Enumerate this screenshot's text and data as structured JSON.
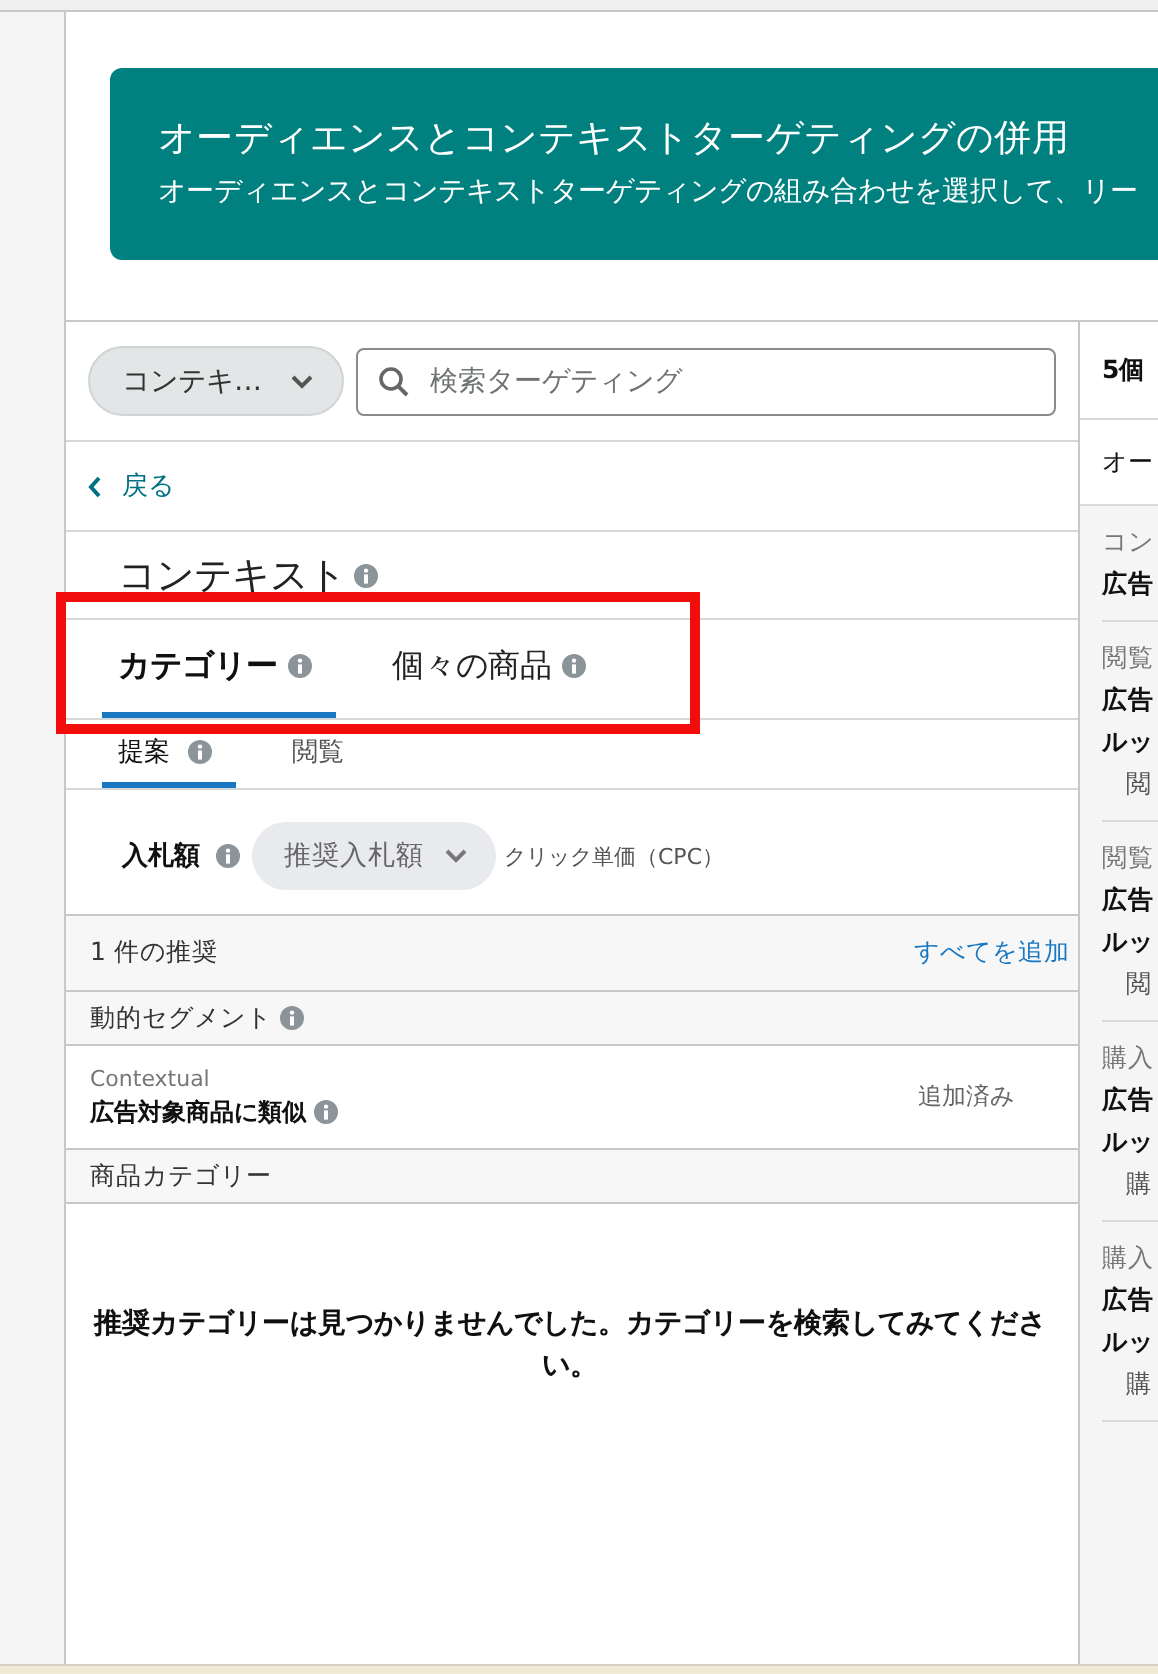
{
  "banner": {
    "title": "オーディエンスとコンテキストターゲティングの併用",
    "text": "オーディエンスとコンテキストターゲティングの組み合わせを選択して、リー"
  },
  "type_select": {
    "value": "コンテキ…"
  },
  "search": {
    "placeholder": "検索ターゲティング"
  },
  "back_link": "戻る",
  "section_title": "コンテキスト",
  "tabs": [
    {
      "label": "カテゴリー",
      "selected": true
    },
    {
      "label": "個々の商品",
      "selected": false
    }
  ],
  "subtabs": [
    {
      "label": "提案",
      "info": true,
      "selected": true
    },
    {
      "label": "閲覧",
      "info": false,
      "selected": false
    }
  ],
  "bid": {
    "label": "入札額",
    "select": "推奨入札額",
    "unit": "クリック単価（CPC）"
  },
  "suggestions": {
    "count": "1 件の推奨",
    "add_all": "すべてを追加"
  },
  "groups": [
    {
      "title": "動的セグメント",
      "info": true,
      "items": [
        {
          "category": "Contextual",
          "name": "広告対象商品に類似",
          "status": "追加済み"
        }
      ]
    },
    {
      "title": "商品カテゴリー",
      "info": false,
      "empty_message": "推奨カテゴリーは見つかりませんでした。カテゴリーを検索してみてください。"
    }
  ],
  "summary": {
    "title": "5個",
    "row": "オー",
    "items": [
      {
        "label": "コン",
        "title_lines": [
          "広告"
        ]
      },
      {
        "label": "閲覧",
        "title_lines": [
          "広告",
          "ルッ"
        ],
        "detail": "閲"
      },
      {
        "label": "閲覧",
        "title_lines": [
          "広告",
          "ルッ"
        ],
        "detail": "閲"
      },
      {
        "label": "購入",
        "title_lines": [
          "広告",
          "ルッ"
        ],
        "detail": "購"
      },
      {
        "label": "購入",
        "title_lines": [
          "広告",
          "ルッ"
        ],
        "detail": "購"
      }
    ]
  }
}
